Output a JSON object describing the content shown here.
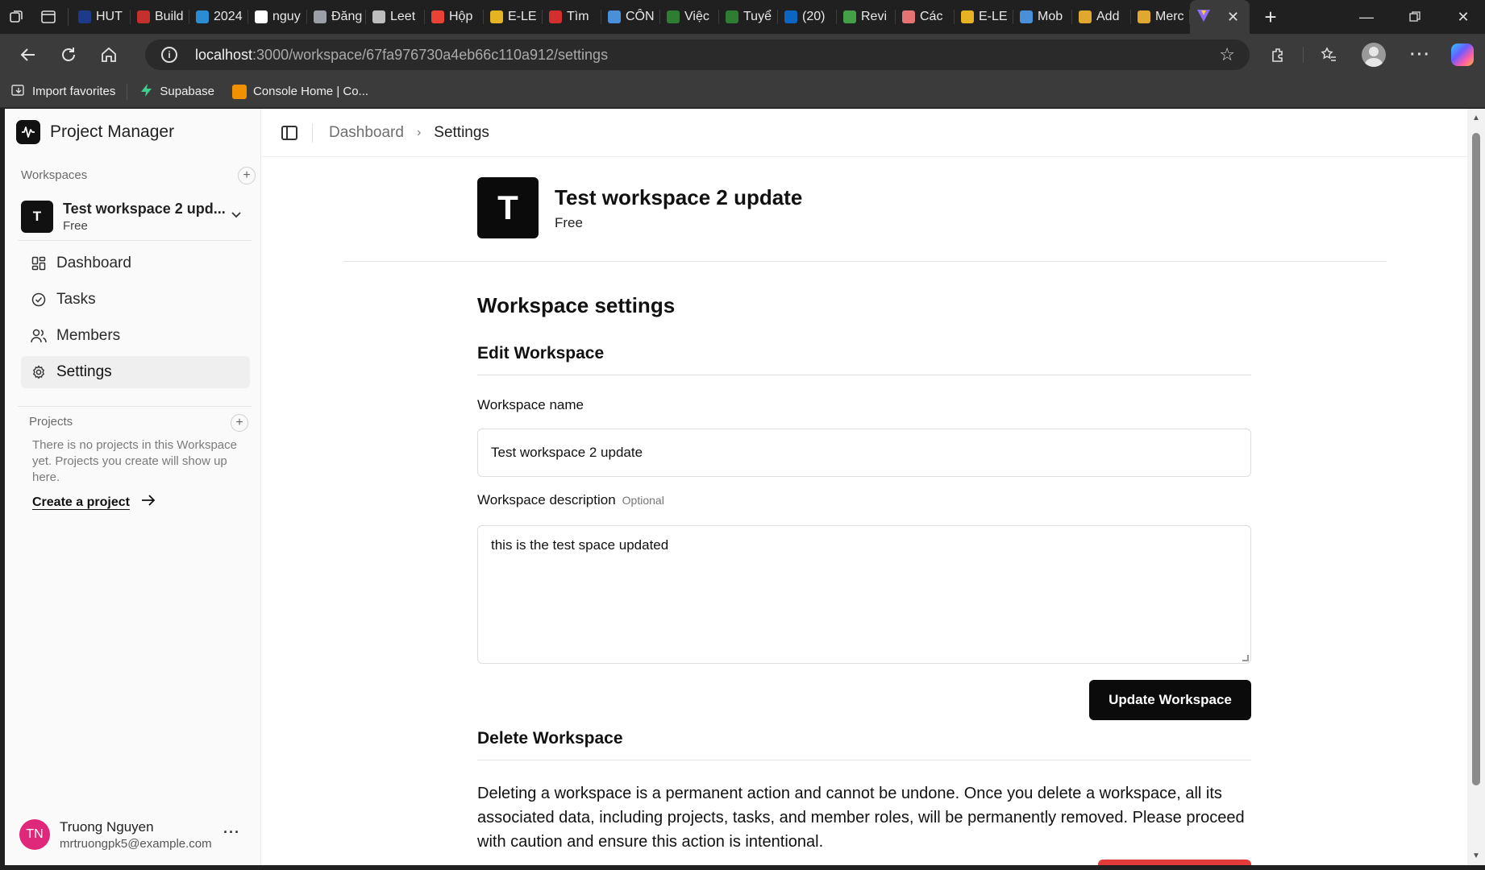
{
  "browser": {
    "tabs": [
      {
        "label": "HUT",
        "color": "#1e3a8a"
      },
      {
        "label": "Build",
        "color": "#c4302b"
      },
      {
        "label": "2024",
        "color": "#2a8dd4"
      },
      {
        "label": "nguy",
        "color": "#ffffff"
      },
      {
        "label": "Đăng",
        "color": "#9aa0a6"
      },
      {
        "label": "Leet",
        "color": "#bdbdbd"
      },
      {
        "label": "Hộp",
        "color": "#ea4335"
      },
      {
        "label": "E-LE",
        "color": "#e6b422"
      },
      {
        "label": "Tìm",
        "color": "#d32f2f"
      },
      {
        "label": "CÔN",
        "color": "#4a90d9"
      },
      {
        "label": "Việc",
        "color": "#2e7d32"
      },
      {
        "label": "Tuyể",
        "color": "#2e7d32"
      },
      {
        "label": "(20)",
        "color": "#0a66c2"
      },
      {
        "label": "Revi",
        "color": "#43a047"
      },
      {
        "label": "Các",
        "color": "#e57373"
      },
      {
        "label": "E-LE",
        "color": "#e6b422"
      },
      {
        "label": "Mob",
        "color": "#4a90d9"
      },
      {
        "label": "Add",
        "color": "#e0a82e"
      },
      {
        "label": "Merc",
        "color": "#e0a82e"
      }
    ],
    "active_tab_icon": "vite-icon",
    "url_host": "localhost",
    "url_path": ":3000/workspace/67fa976730a4eb66c110a912/settings",
    "favorites": [
      {
        "label": "Import favorites",
        "icon": "import-icon"
      },
      {
        "label": "Supabase",
        "icon": "supabase-icon",
        "color": "#3ecf8e"
      },
      {
        "label": "Console Home | Co...",
        "icon": "aws-icon",
        "color": "#f29100"
      }
    ]
  },
  "sidebar": {
    "brand": "Project Manager",
    "workspaces_label": "Workspaces",
    "workspace": {
      "initial": "T",
      "name": "Test workspace 2 upd...",
      "plan": "Free"
    },
    "nav": [
      {
        "label": "Dashboard",
        "icon": "dashboard-icon"
      },
      {
        "label": "Tasks",
        "icon": "tasks-icon"
      },
      {
        "label": "Members",
        "icon": "members-icon"
      },
      {
        "label": "Settings",
        "icon": "settings-icon",
        "active": true
      }
    ],
    "projects_label": "Projects",
    "projects_empty": "There is no projects in this Workspace yet. Projects you create will show up here.",
    "create_project": "Create a project",
    "user": {
      "initials": "TN",
      "name": "Truong Nguyen",
      "email": "mrtruongpk5@example.com",
      "avatar_color": "#e0287a"
    }
  },
  "header": {
    "breadcrumb": [
      "Dashboard",
      "Settings"
    ]
  },
  "main": {
    "workspace_initial": "T",
    "workspace_name": "Test workspace 2 update",
    "workspace_plan": "Free",
    "settings_title": "Workspace settings",
    "edit_title": "Edit Workspace",
    "name_label": "Workspace name",
    "name_value": "Test workspace 2 update",
    "desc_label": "Workspace description",
    "desc_optional": "Optional",
    "desc_value": "this is the test space updated",
    "update_button": "Update Workspace",
    "delete_title": "Delete Workspace",
    "delete_text": "Deleting a workspace is a permanent action and cannot be undone. Once you delete a workspace, all its associated data, including projects, tasks, and member roles, will be permanently removed. Please proceed with caution and ensure this action is intentional.",
    "delete_button_color": "#e23b3b"
  }
}
